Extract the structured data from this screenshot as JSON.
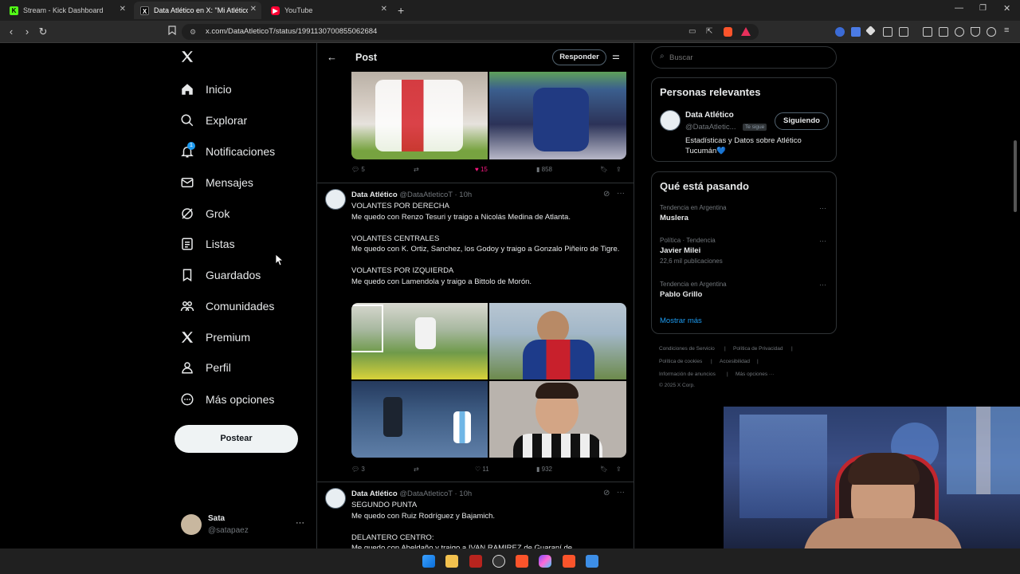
{
  "browser": {
    "tabs": [
      {
        "label": "Stream - Kick Dashboard",
        "icon": "kick-icon",
        "color": "#53fc18",
        "active": false
      },
      {
        "label": "Data Atlético en X: \"Mi Atlético 2",
        "icon": "x-logo-icon",
        "color": "#ffffff",
        "active": true
      },
      {
        "label": "YouTube",
        "icon": "youtube-icon",
        "color": "#ff0033",
        "active": false
      }
    ],
    "url": "x.com/DataAtleticoT/status/1991130700855062684"
  },
  "nav": {
    "items": [
      {
        "label": "Inicio",
        "icon": "home-icon"
      },
      {
        "label": "Explorar",
        "icon": "search-icon"
      },
      {
        "label": "Notificaciones",
        "icon": "bell-icon",
        "badge": "1"
      },
      {
        "label": "Mensajes",
        "icon": "envelope-icon"
      },
      {
        "label": "Grok",
        "icon": "grok-icon"
      },
      {
        "label": "Listas",
        "icon": "list-icon"
      },
      {
        "label": "Guardados",
        "icon": "bookmark-icon"
      },
      {
        "label": "Comunidades",
        "icon": "communities-icon"
      },
      {
        "label": "Premium",
        "icon": "x-premium-icon"
      },
      {
        "label": "Perfil",
        "icon": "profile-icon"
      },
      {
        "label": "Más opciones",
        "icon": "more-circle-icon"
      }
    ],
    "post_button": "Postear",
    "account": {
      "name": "Sata",
      "handle": "@satapaez"
    }
  },
  "main": {
    "header_title": "Post",
    "reply_button": "Responder",
    "first_tweet_actions": {
      "replies": "5",
      "likes": "15",
      "views": "858"
    },
    "tweets": [
      {
        "name": "Data Atlético",
        "handle": "@DataAtleticoT",
        "time": "· 10h",
        "text": "VOLANTES POR DERECHA\nMe quedo con Renzo Tesuri y traigo a Nicolás Medina de Atlanta.\n\nVOLANTES CENTRALES\nMe quedo con K. Ortiz, Sanchez, los Godoy y traigo a Gonzalo Piñeiro de Tigre.\n\nVOLANTES POR IZQUIERDA\nMe quedo con Lamendola y traigo a Bittolo de Morón.",
        "replies": "3",
        "likes": "11",
        "views": "932"
      },
      {
        "name": "Data Atlético",
        "handle": "@DataAtleticoT",
        "time": "· 10h",
        "text": "SEGUNDO PUNTA\nMe quedo con Ruiz Rodríguez y Bajamich.\n\nDELANTERO CENTRO:\nMe quedo con Abeldaño y traigo a IVAN RAMIREZ de Guaraní de"
      }
    ]
  },
  "sidebar": {
    "search_placeholder": "Buscar",
    "relevant": {
      "title": "Personas relevantes",
      "name": "Data Atlético",
      "handle": "@DataAtletic...",
      "follows_you": "Te sigue",
      "button": "Siguiendo",
      "bio": "Estadísticas y Datos sobre Atlético Tucumán💙"
    },
    "trends": {
      "title": "Qué está pasando",
      "items": [
        {
          "context": "Tendencia en Argentina",
          "name": "Muslera",
          "posts": ""
        },
        {
          "context": "Política · Tendencia",
          "name": "Javier Milei",
          "posts": "22,6 mil publicaciones"
        },
        {
          "context": "Tendencia en Argentina",
          "name": "Pablo Grillo",
          "posts": ""
        }
      ],
      "show_more": "Mostrar más"
    },
    "footer": {
      "links1": "Condiciones de Servicio",
      "links2": "Política de Privacidad",
      "links3": "Política de cookies",
      "links4": "Accesibilidad",
      "links5": "Información de anuncios",
      "links6": "Más opciones ···",
      "copyright": "© 2025 X Corp."
    }
  },
  "colors": {
    "accent": "#1d9bf0",
    "like": "#f91880"
  }
}
